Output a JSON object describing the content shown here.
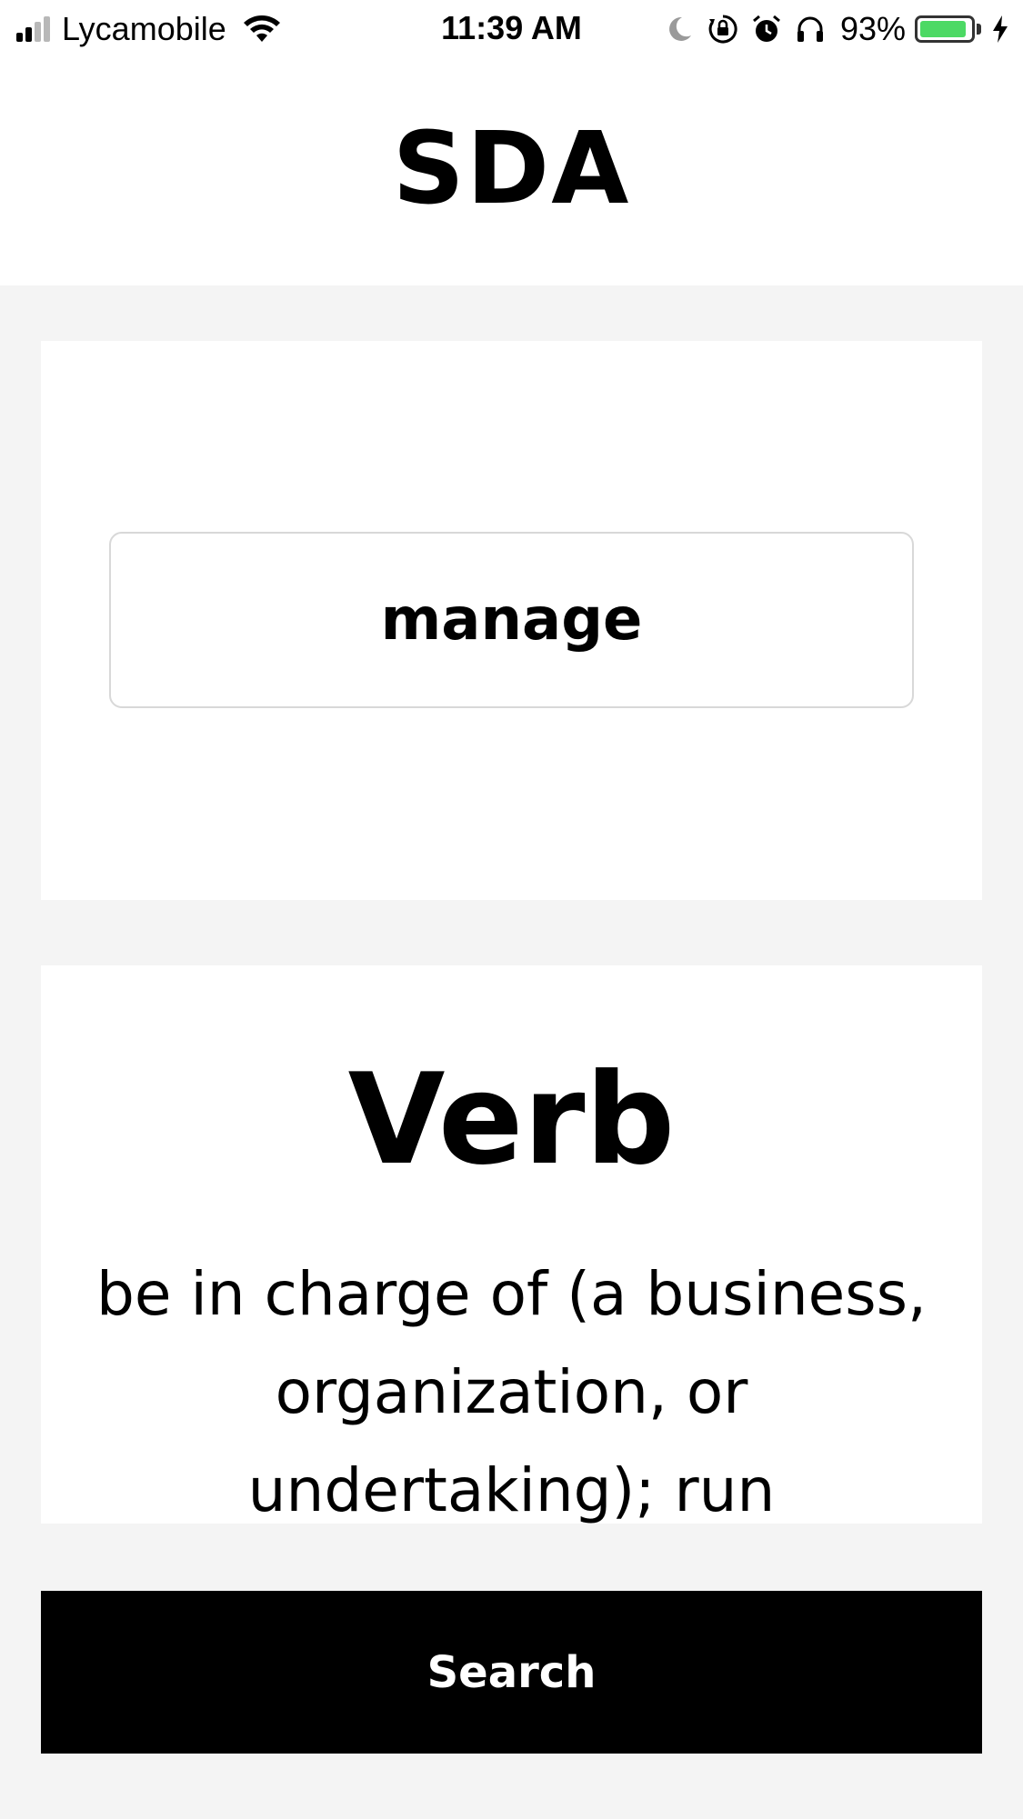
{
  "status_bar": {
    "carrier": "Lycamobile",
    "time": "11:39 AM",
    "battery_percent_label": "93%",
    "battery_level": 0.93,
    "signal_bars": 2,
    "signal_bars_total": 4,
    "icons": [
      "signal-icon",
      "wifi-icon",
      "moon-icon",
      "rotation-lock-icon",
      "alarm-icon",
      "headphones-icon",
      "battery-icon",
      "charging-bolt-icon"
    ],
    "battery_color": "#4cd964"
  },
  "header": {
    "title": "SDA"
  },
  "search": {
    "value": "manage"
  },
  "result": {
    "part_of_speech": "Verb",
    "definition": "be in charge of (a business, organization, or undertaking); run"
  },
  "actions": {
    "search_label": "Search"
  }
}
